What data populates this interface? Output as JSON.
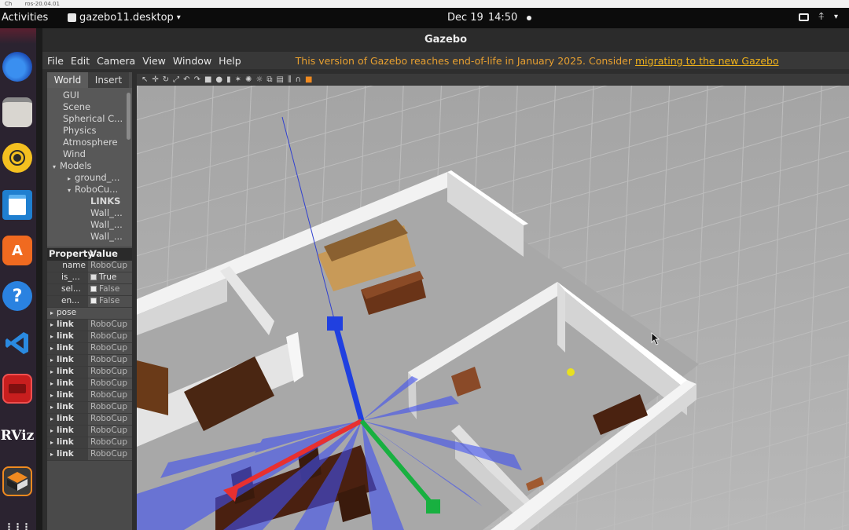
{
  "browser": {
    "tab1": "Ch",
    "tab2": "ros-20.04.01"
  },
  "topbar": {
    "activities": "Activities",
    "app_menu": "gazebo11.desktop",
    "app_menu_caret": "▾",
    "date": "Dec 19",
    "time": "14:50",
    "tray_caret": "▾"
  },
  "dock": {
    "items": [
      "firefox-icon",
      "files-icon",
      "rhythmbox-icon",
      "writer-icon",
      "software-center-icon",
      "help-icon",
      "vscode-icon",
      "terminal-icon",
      "rviz-icon",
      "gazebo-icon",
      "app-grid-icon"
    ],
    "rviz_label": "RViz",
    "help_glyph": "?",
    "grid_glyph": "⋮⋮⋮"
  },
  "window": {
    "title": "Gazebo",
    "menu": [
      "File",
      "Edit",
      "Camera",
      "View",
      "Window",
      "Help"
    ],
    "notice_text": "This version of Gazebo reaches end-of-life in January 2025. Consider ",
    "notice_link": "migrating to the new Gazebo"
  },
  "left_panel": {
    "tabs": [
      "World",
      "Insert"
    ],
    "tree": {
      "gui": "GUI",
      "scene": "Scene",
      "spherical": "Spherical C...",
      "physics": "Physics",
      "atmosphere": "Atmosphere",
      "wind": "Wind",
      "models": "Models",
      "model_ground": "ground_...",
      "model_robocup": "RoboCu...",
      "links_header": "LINKS",
      "link1": "Wall_...",
      "link2": "Wall_...",
      "link3": "Wall_..."
    },
    "props": {
      "header_property": "Property",
      "header_value": "Value",
      "name_k": "name",
      "name_v": "RoboCup",
      "is_k": "is_...",
      "is_v": "True",
      "sel_k": "sel...",
      "sel_v": "False",
      "en_k": "en...",
      "en_v": "False",
      "pose_k": "pose",
      "link_k": "link",
      "link_v": "RoboCup",
      "link_rows": 12
    }
  },
  "colors": {
    "accent_orange": "#f0b21a",
    "axis_x": "#e83030",
    "axis_y": "#18b040",
    "axis_z": "#2040e0",
    "ground": "#b0b0b0",
    "wall": "#e8e8e8",
    "furniture": "#5a2c14"
  }
}
